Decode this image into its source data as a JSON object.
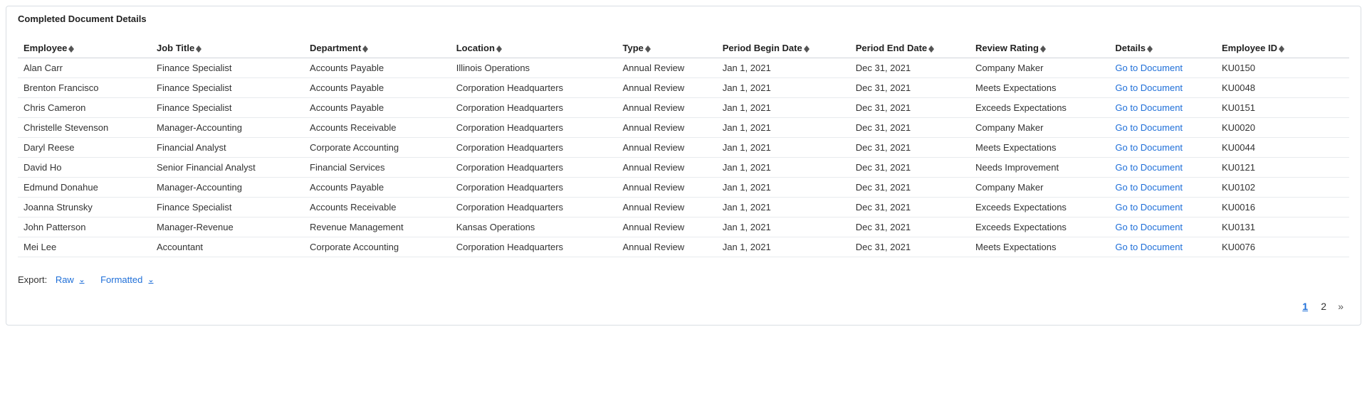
{
  "panel": {
    "title": "Completed Document Details"
  },
  "columns": [
    {
      "label": "Employee"
    },
    {
      "label": "Job Title"
    },
    {
      "label": "Department"
    },
    {
      "label": "Location"
    },
    {
      "label": "Type"
    },
    {
      "label": "Period Begin Date"
    },
    {
      "label": "Period End Date"
    },
    {
      "label": "Review Rating"
    },
    {
      "label": "Details"
    },
    {
      "label": "Employee ID"
    }
  ],
  "rows": [
    {
      "employee": "Alan Carr",
      "job": "Finance Specialist",
      "dept": "Accounts Payable",
      "loc": "Illinois Operations",
      "type": "Annual Review",
      "begin": "Jan 1, 2021",
      "end": "Dec 31, 2021",
      "rating": "Company Maker",
      "details": "Go to Document",
      "empid": "KU0150"
    },
    {
      "employee": "Brenton Francisco",
      "job": "Finance Specialist",
      "dept": "Accounts Payable",
      "loc": "Corporation Headquarters",
      "type": "Annual Review",
      "begin": "Jan 1, 2021",
      "end": "Dec 31, 2021",
      "rating": "Meets Expectations",
      "details": "Go to Document",
      "empid": "KU0048"
    },
    {
      "employee": "Chris Cameron",
      "job": "Finance Specialist",
      "dept": "Accounts Payable",
      "loc": "Corporation Headquarters",
      "type": "Annual Review",
      "begin": "Jan 1, 2021",
      "end": "Dec 31, 2021",
      "rating": "Exceeds Expectations",
      "details": "Go to Document",
      "empid": "KU0151"
    },
    {
      "employee": "Christelle Stevenson",
      "job": "Manager-Accounting",
      "dept": "Accounts Receivable",
      "loc": "Corporation Headquarters",
      "type": "Annual Review",
      "begin": "Jan 1, 2021",
      "end": "Dec 31, 2021",
      "rating": "Company Maker",
      "details": "Go to Document",
      "empid": "KU0020"
    },
    {
      "employee": "Daryl Reese",
      "job": "Financial Analyst",
      "dept": "Corporate Accounting",
      "loc": "Corporation Headquarters",
      "type": "Annual Review",
      "begin": "Jan 1, 2021",
      "end": "Dec 31, 2021",
      "rating": "Meets Expectations",
      "details": "Go to Document",
      "empid": "KU0044"
    },
    {
      "employee": "David Ho",
      "job": "Senior Financial Analyst",
      "dept": "Financial Services",
      "loc": "Corporation Headquarters",
      "type": "Annual Review",
      "begin": "Jan 1, 2021",
      "end": "Dec 31, 2021",
      "rating": "Needs Improvement",
      "details": "Go to Document",
      "empid": "KU0121"
    },
    {
      "employee": "Edmund Donahue",
      "job": "Manager-Accounting",
      "dept": "Accounts Payable",
      "loc": "Corporation Headquarters",
      "type": "Annual Review",
      "begin": "Jan 1, 2021",
      "end": "Dec 31, 2021",
      "rating": "Company Maker",
      "details": "Go to Document",
      "empid": "KU0102"
    },
    {
      "employee": "Joanna Strunsky",
      "job": "Finance Specialist",
      "dept": "Accounts Receivable",
      "loc": "Corporation Headquarters",
      "type": "Annual Review",
      "begin": "Jan 1, 2021",
      "end": "Dec 31, 2021",
      "rating": "Exceeds Expectations",
      "details": "Go to Document",
      "empid": "KU0016"
    },
    {
      "employee": "John Patterson",
      "job": "Manager-Revenue",
      "dept": "Revenue Management",
      "loc": "Kansas Operations",
      "type": "Annual Review",
      "begin": "Jan 1, 2021",
      "end": "Dec 31, 2021",
      "rating": "Exceeds Expectations",
      "details": "Go to Document",
      "empid": "KU0131"
    },
    {
      "employee": "Mei Lee",
      "job": "Accountant",
      "dept": "Corporate Accounting",
      "loc": "Corporation Headquarters",
      "type": "Annual Review",
      "begin": "Jan 1, 2021",
      "end": "Dec 31, 2021",
      "rating": "Meets Expectations",
      "details": "Go to Document",
      "empid": "KU0076"
    }
  ],
  "export": {
    "label": "Export:",
    "raw": "Raw",
    "formatted": "Formatted"
  },
  "pagination": {
    "pages": [
      "1",
      "2"
    ],
    "current": "1",
    "next": "»"
  }
}
